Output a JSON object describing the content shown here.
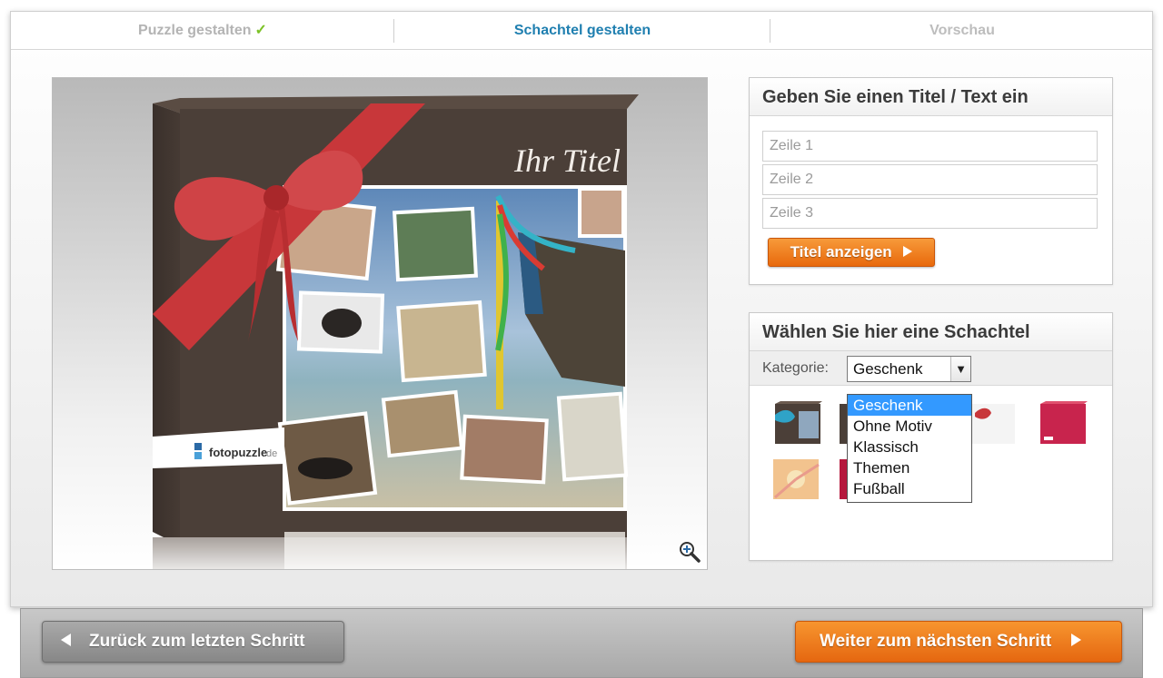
{
  "steps": {
    "step1": "Puzzle gestalten",
    "step1_check": "✓",
    "step2": "Schachtel gestalten",
    "step3": "Vorschau"
  },
  "preview": {
    "box_title": "Ihr Titel",
    "brand": "fotopuzzle",
    "brand_suffix": ".de"
  },
  "title_panel": {
    "heading": "Geben Sie einen Titel / Text ein",
    "lines": [
      {
        "placeholder": "Zeile 1",
        "value": ""
      },
      {
        "placeholder": "Zeile 2",
        "value": ""
      },
      {
        "placeholder": "Zeile 3",
        "value": ""
      }
    ],
    "show_button": "Titel anzeigen"
  },
  "box_panel": {
    "heading": "Wählen Sie hier eine Schachtel",
    "category_label": "Kategorie:",
    "category_selected": "Geschenk",
    "category_options": [
      "Geschenk",
      "Ohne Motiv",
      "Klassisch",
      "Themen",
      "Fußball"
    ]
  },
  "nav": {
    "back": "Zurück zum letzten Schritt",
    "next": "Weiter zum nächsten Schritt"
  },
  "colors": {
    "accent_blue": "#1f7fb0",
    "check_green": "#7cc227",
    "orange": "#ee7a1d",
    "box_brown": "#4b3f38",
    "ribbon_red": "#c8373a",
    "select_blue": "#3399ff"
  }
}
